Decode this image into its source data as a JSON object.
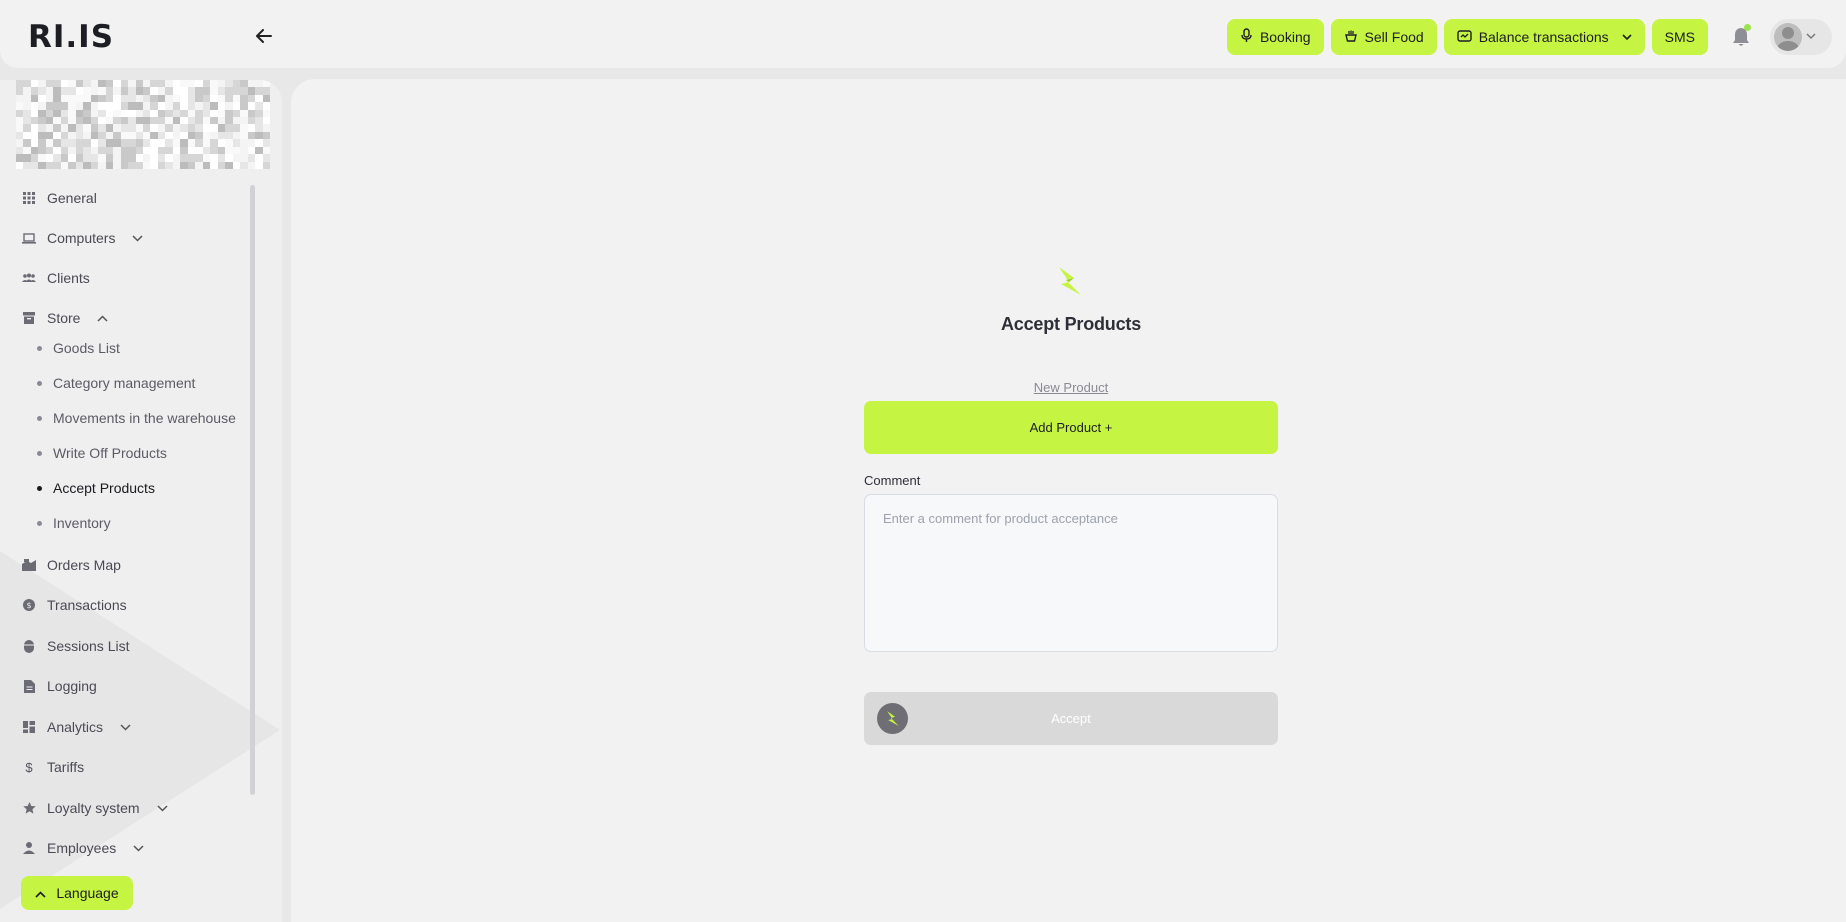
{
  "header": {
    "logo_text": "RI.IS",
    "actions": [
      {
        "label": "Booking",
        "icon": "microphone-icon"
      },
      {
        "label": "Sell Food",
        "icon": "food-bowl-icon"
      },
      {
        "label": "Balance transactions",
        "icon": "wallet-icon"
      },
      {
        "label": "SMS"
      }
    ],
    "notification_dot_color": "#9be34a"
  },
  "sidebar": {
    "items": [
      {
        "label": "General",
        "icon": "grid-icon"
      },
      {
        "label": "Computers",
        "icon": "laptop-icon"
      },
      {
        "label": "Clients",
        "icon": "users-icon"
      },
      {
        "label": "Store",
        "icon": "store-icon"
      },
      {
        "label": "Orders Map",
        "icon": "map-icon"
      },
      {
        "label": "Transactions",
        "icon": "coin-icon"
      },
      {
        "label": "Sessions List",
        "icon": "mouse-icon"
      },
      {
        "label": "Logging",
        "icon": "document-icon"
      },
      {
        "label": "Analytics",
        "icon": "dashboard-icon"
      },
      {
        "label": "Tariffs",
        "icon": "dollar-icon"
      },
      {
        "label": "Loyalty system",
        "icon": "star-icon"
      },
      {
        "label": "Employees",
        "icon": "person-icon"
      }
    ],
    "store_subitems": [
      {
        "label": "Goods List"
      },
      {
        "label": "Category management"
      },
      {
        "label": "Movements in the warehouse"
      },
      {
        "label": "Write Off Products"
      },
      {
        "label": "Accept Products",
        "active": true
      },
      {
        "label": "Inventory"
      }
    ],
    "language_label": "Language"
  },
  "main": {
    "title": "Accept Products",
    "new_product_link": "New Product",
    "add_product_label": "Add Product +",
    "comment_label": "Comment",
    "comment_placeholder": "Enter a comment for product acceptance",
    "accept_label": "Accept"
  },
  "colors": {
    "accent": "#c5f542",
    "disabled_button": "#d9d9d9",
    "background": "#f2f2f2"
  }
}
